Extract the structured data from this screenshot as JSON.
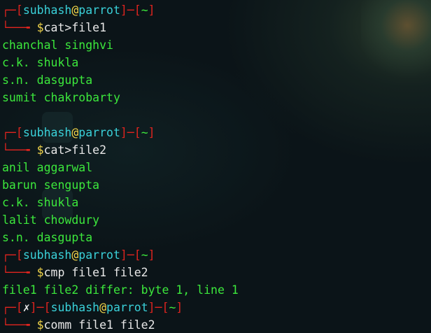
{
  "prompt": {
    "user": "subhash",
    "at": "@",
    "host": "parrot",
    "dir": "~",
    "error_mark": "✗",
    "dollar": "$"
  },
  "blocks": [
    {
      "command": "cat>file1",
      "output": [
        "chanchal singhvi",
        "c.k. shukla",
        "s.n. dasgupta",
        "sumit chakrobarty"
      ]
    },
    {
      "command": "cat>file2",
      "output": [
        "anil aggarwal",
        "barun sengupta",
        "c.k. shukla",
        "lalit chowdury",
        "s.n. dasgupta"
      ]
    },
    {
      "command": "cmp file1 file2",
      "output": [
        "file1 file2 differ: byte 1, line 1"
      ]
    },
    {
      "command": "comm file1 file2",
      "output": []
    }
  ]
}
